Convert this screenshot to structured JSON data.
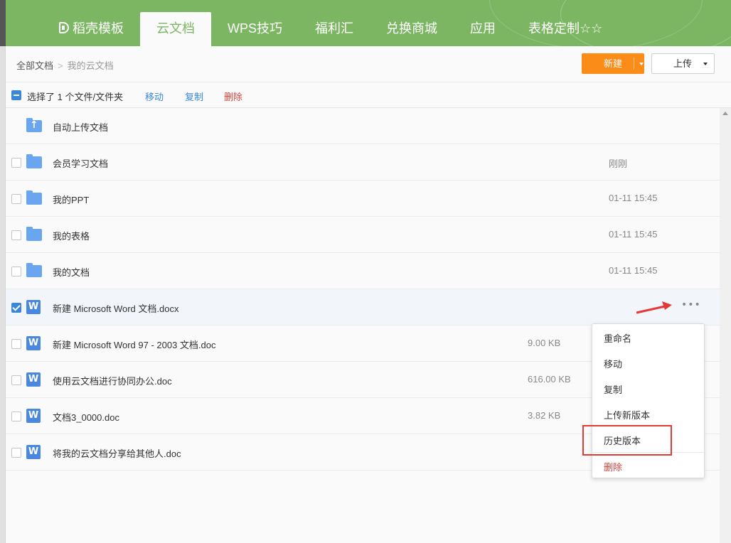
{
  "nav": {
    "tabs": [
      {
        "label": "稻壳模板"
      },
      {
        "label": "云文档",
        "active": true
      },
      {
        "label": "WPS技巧"
      },
      {
        "label": "福利汇"
      },
      {
        "label": "兑换商城"
      },
      {
        "label": "应用"
      },
      {
        "label": "表格定制☆☆"
      }
    ]
  },
  "breadcrumb": {
    "root": "全部文档",
    "current": "我的云文档"
  },
  "toolbar": {
    "new_label": "新建",
    "upload_label": "上传"
  },
  "selection": {
    "text": "选择了 1 个文件/文件夹",
    "move": "移动",
    "copy": "复制",
    "delete": "删除"
  },
  "files": [
    {
      "name": "自动上传文档",
      "type": "folder-upload",
      "size": "",
      "date": ""
    },
    {
      "name": "会员学习文档",
      "type": "folder",
      "size": "",
      "date": "刚刚"
    },
    {
      "name": "我的PPT",
      "type": "folder",
      "size": "",
      "date": "01-11 15:45"
    },
    {
      "name": "我的表格",
      "type": "folder",
      "size": "",
      "date": "01-11 15:45"
    },
    {
      "name": "我的文档",
      "type": "folder",
      "size": "",
      "date": "01-11 15:45"
    },
    {
      "name": "新建 Microsoft Word 文档.docx",
      "type": "word",
      "size": "",
      "date": "",
      "checked": true
    },
    {
      "name": "新建 Microsoft Word 97 - 2003 文档.doc",
      "type": "word",
      "size": "9.00 KB",
      "date": ""
    },
    {
      "name": "使用云文档进行协同办公.doc",
      "type": "word",
      "size": "616.00 KB",
      "date": ""
    },
    {
      "name": "文档3_0000.doc",
      "type": "word",
      "size": "3.82 KB",
      "date": ""
    },
    {
      "name": "将我的云文档分享给其他人.doc",
      "type": "word",
      "size": "",
      "date": ""
    }
  ],
  "word_icon_glyph": "W",
  "more_glyph": "•••",
  "context_menu": {
    "items": [
      {
        "label": "重命名"
      },
      {
        "label": "移动"
      },
      {
        "label": "复制"
      },
      {
        "label": "上传新版本"
      },
      {
        "label": "历史版本"
      },
      {
        "label": "删除"
      }
    ]
  },
  "colors": {
    "nav_green": "#7cb663",
    "new_orange": "#fb8c18",
    "link_blue": "#3a86d8",
    "danger_red": "#e0433c",
    "annotation_red": "#e53935"
  }
}
